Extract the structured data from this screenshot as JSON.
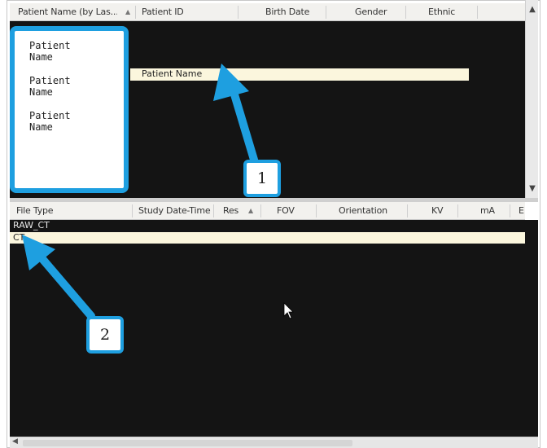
{
  "patient_table": {
    "columns": [
      {
        "label": "Patient Name (by Las...",
        "sort_indicator": "▲"
      },
      {
        "label": "Patient ID"
      },
      {
        "label": "Birth Date"
      },
      {
        "label": "Gender"
      },
      {
        "label": "Ethnic"
      }
    ],
    "popup_items": [
      "Patient Name",
      "Patient Name",
      "Patient Name"
    ],
    "selected_row_label": "Patient Name"
  },
  "file_table": {
    "columns": [
      {
        "label": "File Type"
      },
      {
        "label": "Study Date-Time"
      },
      {
        "label": "Res",
        "sort_indicator": "▲"
      },
      {
        "label": "FOV"
      },
      {
        "label": "Orientation"
      },
      {
        "label": "KV"
      },
      {
        "label": "mA"
      },
      {
        "label": "E"
      }
    ],
    "rows": [
      "RAW_CT",
      "CT"
    ]
  },
  "callouts": {
    "one": "1",
    "two": "2"
  },
  "colors": {
    "callout": "#1e9fe0",
    "pane_background": "#141414",
    "highlight_row": "#fbf6dd"
  }
}
